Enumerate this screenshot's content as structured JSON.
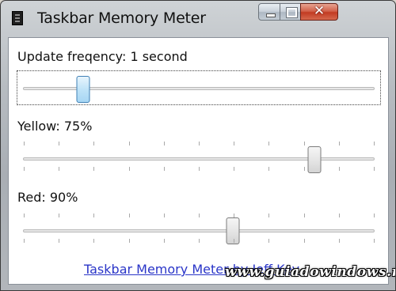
{
  "window": {
    "title": "Taskbar Memory Meter",
    "icon": "app-icon",
    "buttons": {
      "minimize_icon": "minimize-icon",
      "maximize_icon": "maximize-icon",
      "close_icon": "close-icon",
      "close_glyph": "✕"
    }
  },
  "update": {
    "label": "Update freqency: 1 second",
    "slider_level": 0.16
  },
  "yellow": {
    "label": "Yellow: 75%",
    "slider_level": 0.84
  },
  "red": {
    "label": "Red: 90%",
    "slider_level": 0.6
  },
  "link": {
    "text": "Taskbar Memory Meter by Jeff Key"
  },
  "watermark": {
    "text": "www.guiadowindows.net"
  }
}
